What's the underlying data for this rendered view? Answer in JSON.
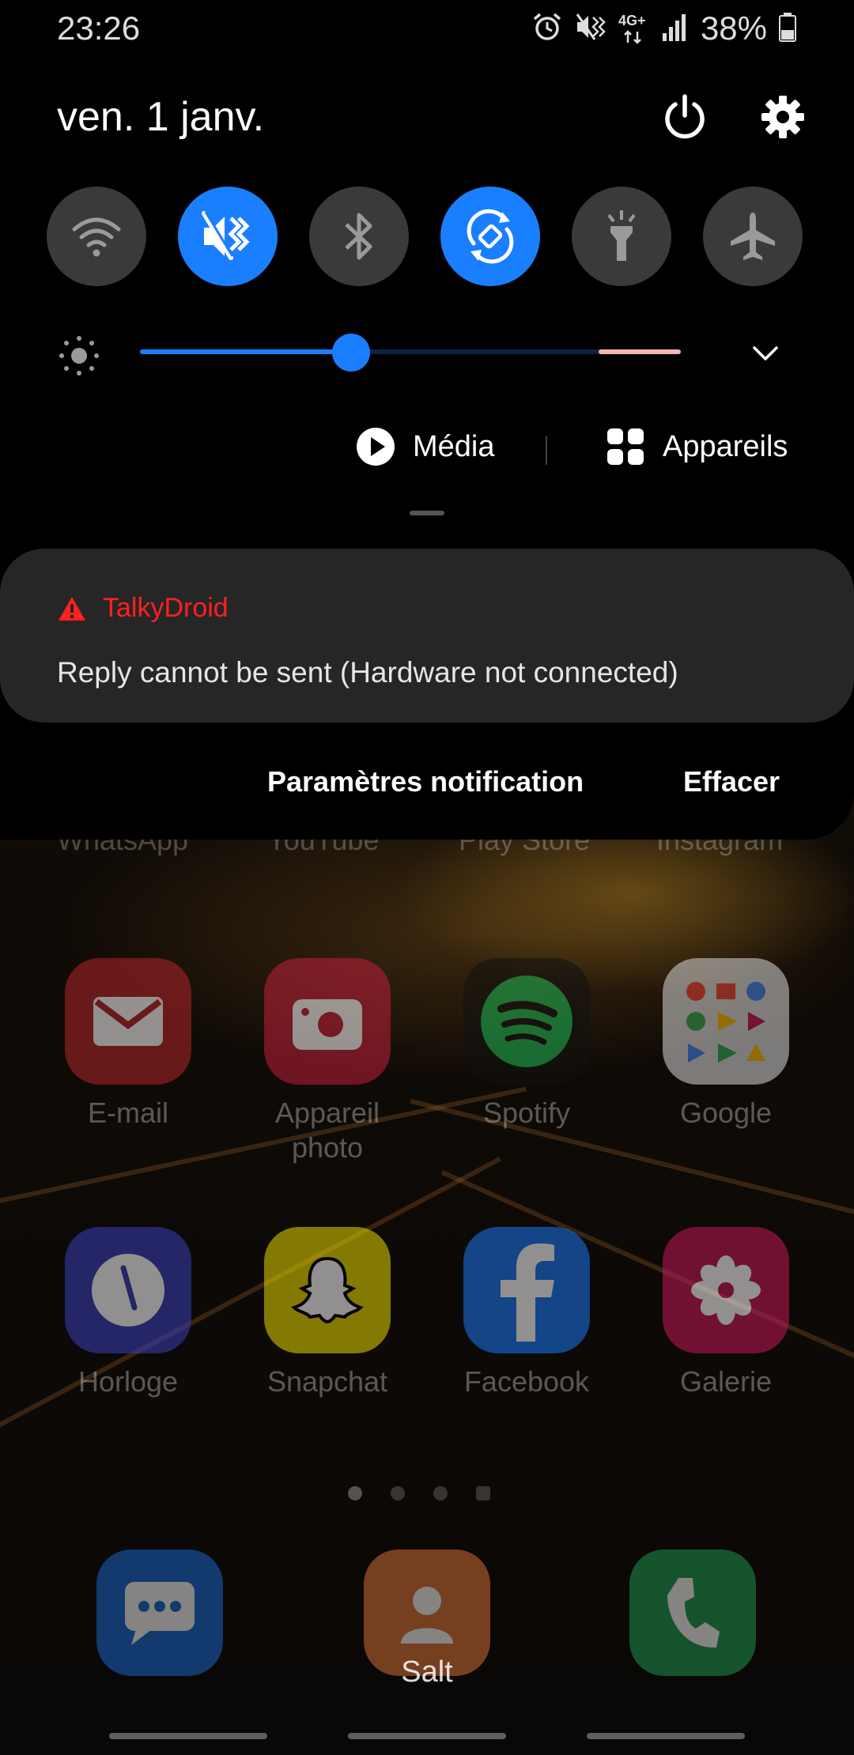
{
  "status_bar": {
    "time": "23:26",
    "network_type": "4G+",
    "battery_percent": "38%",
    "icons": [
      "alarm-icon",
      "vibrate-icon",
      "network-4g-icon",
      "signal-icon",
      "battery-icon"
    ]
  },
  "header": {
    "date": "ven. 1 janv.",
    "power_icon": "power-icon",
    "settings_icon": "gear-icon"
  },
  "quick_tiles": [
    {
      "name": "wifi",
      "icon": "wifi-icon",
      "on": false
    },
    {
      "name": "sound-mode",
      "icon": "vibrate-icon",
      "on": true
    },
    {
      "name": "bluetooth",
      "icon": "bluetooth-icon",
      "on": false
    },
    {
      "name": "auto-rotate",
      "icon": "rotate-icon",
      "on": true
    },
    {
      "name": "flashlight",
      "icon": "flashlight-icon",
      "on": false
    },
    {
      "name": "airplane-mode",
      "icon": "airplane-icon",
      "on": false
    }
  ],
  "brightness": {
    "level": 0.39
  },
  "media_row": {
    "media_label": "Média",
    "devices_label": "Appareils"
  },
  "notification": {
    "app_name": "TalkyDroid",
    "message": "Reply cannot be sent (Hardware not connected)",
    "actions": {
      "settings": "Paramètres notification",
      "clear": "Effacer"
    }
  },
  "home_screen": {
    "partial_labels": [
      "WhatsApp",
      "YouTube",
      "Play Store",
      "Instagram"
    ],
    "row1": [
      {
        "label": "E-mail",
        "icon": "email-icon",
        "color": "#b3262b"
      },
      {
        "label": "Appareil photo",
        "icon": "camera-icon",
        "color": "#c0203c"
      },
      {
        "label": "Spotify",
        "icon": "spotify-icon",
        "color": "#1db954"
      },
      {
        "label": "Google",
        "icon": "google-folder-icon",
        "color": "#d8d8d8"
      }
    ],
    "row2": [
      {
        "label": "Horloge",
        "icon": "clock-icon",
        "color": "#3a3fb8"
      },
      {
        "label": "Snapchat",
        "icon": "snapchat-icon",
        "color": "#e6d600"
      },
      {
        "label": "Facebook",
        "icon": "facebook-icon",
        "color": "#1877f2"
      },
      {
        "label": "Galerie",
        "icon": "gallery-icon",
        "color": "#c2185b"
      }
    ],
    "dock": [
      {
        "label": "",
        "icon": "messages-icon",
        "color": "#1a6cd6"
      },
      {
        "label": "Salt",
        "icon": "contacts-icon",
        "color": "#e0763a"
      },
      {
        "label": "",
        "icon": "phone-icon",
        "color": "#1f9e55"
      }
    ]
  }
}
